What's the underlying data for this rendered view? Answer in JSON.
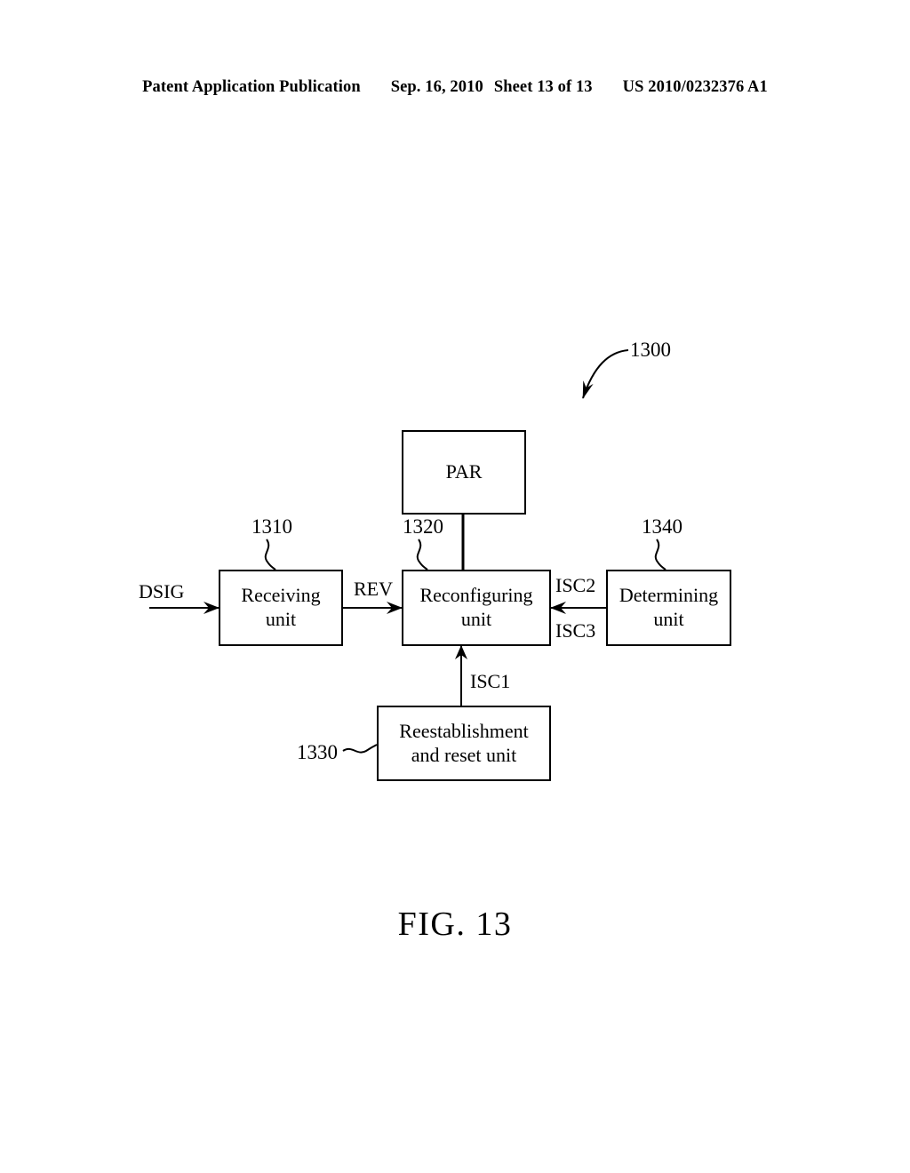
{
  "header": {
    "publication": "Patent Application Publication",
    "date": "Sep. 16, 2010",
    "sheet": "Sheet 13 of 13",
    "patent_number": "US 2010/0232376 A1"
  },
  "figure": {
    "caption": "FIG. 13",
    "system_reference": "1300",
    "blocks": [
      {
        "id": "par",
        "label_line1": "PAR",
        "label_line2": "",
        "reference": ""
      },
      {
        "id": "receiving",
        "label_line1": "Receiving",
        "label_line2": "unit",
        "reference": "1310"
      },
      {
        "id": "reconfiguring",
        "label_line1": "Reconfiguring",
        "label_line2": "unit",
        "reference": "1320"
      },
      {
        "id": "determining",
        "label_line1": "Determining",
        "label_line2": "unit",
        "reference": "1340"
      },
      {
        "id": "reestablish",
        "label_line1": "Reestablishment",
        "label_line2": "and reset unit",
        "reference": "1330"
      }
    ],
    "signals": [
      {
        "id": "dsig",
        "label": "DSIG",
        "from": "input",
        "to": "receiving"
      },
      {
        "id": "rev",
        "label": "REV",
        "from": "receiving",
        "to": "reconfiguring"
      },
      {
        "id": "isc2",
        "label": "ISC2",
        "from": "determining",
        "to": "reconfiguring"
      },
      {
        "id": "isc3",
        "label": "ISC3",
        "from": "determining",
        "to": "reconfiguring"
      },
      {
        "id": "isc1",
        "label": "ISC1",
        "from": "reestablish",
        "to": "reconfiguring"
      }
    ],
    "colors": {
      "line": "#000000",
      "background": "#ffffff",
      "text": "#000000"
    }
  }
}
